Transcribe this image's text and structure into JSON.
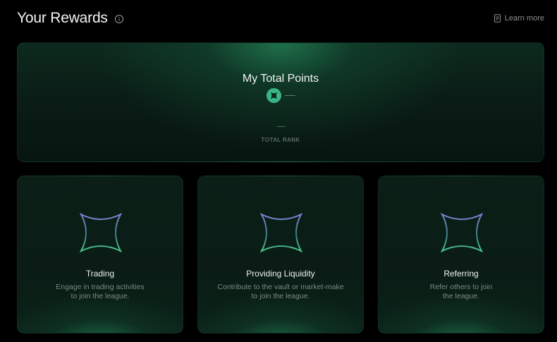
{
  "header": {
    "title": "Your Rewards",
    "learn_more": "Learn more"
  },
  "total": {
    "title": "My Total Points",
    "points_value": "—",
    "rank_value": "—",
    "rank_label": "TOTAL RANK"
  },
  "categories": [
    {
      "title": "Trading",
      "desc_line1": "Engage in trading activities",
      "desc_line2": "to join the league."
    },
    {
      "title": "Providing Liquidity",
      "desc_line1": "Contribute to the vault or market-make",
      "desc_line2": "to join the league."
    },
    {
      "title": "Referring",
      "desc_line1": "Refer others to join",
      "desc_line2": "the league."
    }
  ],
  "colors": {
    "accent": "#3cb584",
    "background": "#000000",
    "card": "#0a1d16"
  }
}
